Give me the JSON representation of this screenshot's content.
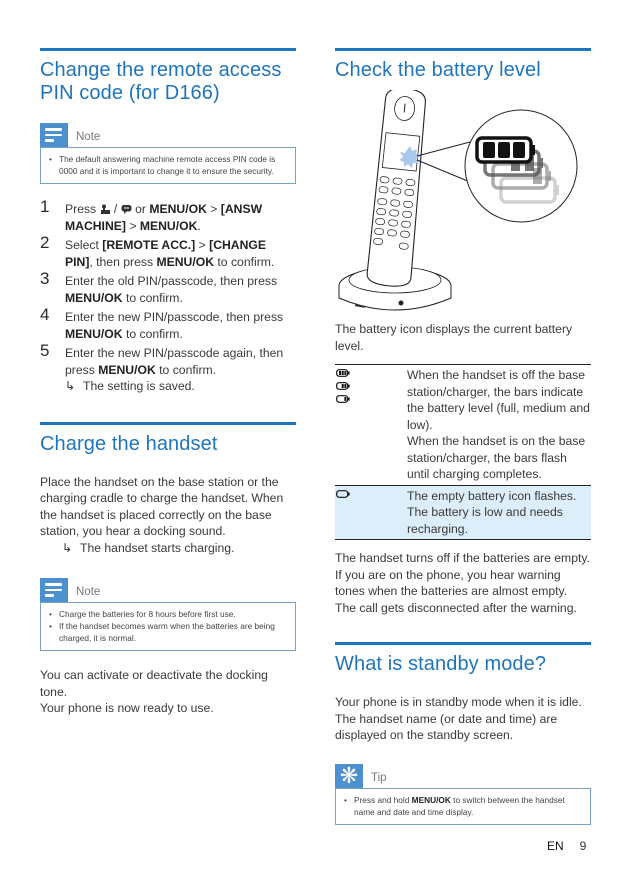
{
  "left": {
    "section1": {
      "title_line1": "Change the remote access",
      "title_line2": "PIN code (for D166)",
      "note": {
        "label": "Note",
        "icon": "note-icon",
        "items": [
          "The default answering machine remote access PIN code is 0000 and it is important to change it to ensure the security."
        ]
      },
      "steps": [
        {
          "num": "1",
          "parts": {
            "pre": "Press ",
            "icon1": "answering-machine-icon",
            "sep": " / ",
            "icon2": "message-icon",
            "mid": " or ",
            "bold1": "MENU/OK",
            "gt": " > ",
            "bold2": "[ANSW MACHINE]",
            "gt2": " > ",
            "bold3": "MENU/OK",
            "end": "."
          }
        },
        {
          "num": "2",
          "parts": {
            "pre": "Select ",
            "bold1": "[REMOTE ACC.]",
            "gt": " > ",
            "bold2": "[CHANGE PIN]",
            "mid": ", then press ",
            "bold3": "MENU/OK",
            "end": " to confirm."
          }
        },
        {
          "num": "3",
          "parts": {
            "pre": "Enter the old PIN/passcode, then press ",
            "bold1": "MENU/OK",
            "end": " to confirm."
          }
        },
        {
          "num": "4",
          "parts": {
            "pre": "Enter the new PIN/passcode, then press ",
            "bold1": "MENU/OK",
            "end": " to confirm."
          }
        },
        {
          "num": "5",
          "parts": {
            "pre": "Enter the new PIN/passcode again, then press ",
            "bold1": "MENU/OK",
            "end": " to confirm."
          },
          "result": "The setting is saved."
        }
      ]
    },
    "section2": {
      "title": "Charge the handset",
      "paragraph": "Place the handset on the base station or the charging cradle to charge the handset. When the handset is placed correctly on the base station, you hear a docking sound.",
      "result": "The handset starts charging.",
      "note": {
        "label": "Note",
        "icon": "note-icon",
        "items": [
          "Charge the batteries for 8 hours before first use.",
          "If the handset becomes warm when the batteries are being charged, it is normal."
        ]
      },
      "closing_line1": "You can activate or deactivate the docking tone.",
      "closing_line2": "Your phone is now ready to use."
    }
  },
  "right": {
    "section3": {
      "title": "Check the battery level",
      "illustration": "phone-base-battery-illustration",
      "intro": "The battery icon displays the current battery level.",
      "table": [
        {
          "icons": [
            "battery-full-icon",
            "battery-medium-icon",
            "battery-low-icon"
          ],
          "text1": "When the handset is off the base station/charger, the bars indicate the battery level (full, medium and low).",
          "text2": "When the handset is on the base station/charger, the bars flash until charging completes.",
          "highlight": false
        },
        {
          "icons": [
            "battery-empty-icon"
          ],
          "text1": "The empty battery icon flashes. The battery is low and needs recharging.",
          "highlight": true
        }
      ],
      "after": "The handset turns off if the batteries are empty. If you are on the phone, you hear warning tones when the batteries are almost empty. The call gets disconnected after the warning."
    },
    "section4": {
      "title": "What is standby mode?",
      "paragraph": "Your phone is in standby mode when it is idle. The handset name (or date and time) are displayed on the standby screen.",
      "tip": {
        "label": "Tip",
        "icon": "tip-icon",
        "pre": "Press and hold ",
        "bold": "MENU/OK",
        "post": " to switch between the handset name and date and time display."
      }
    }
  },
  "footer": {
    "lang": "EN",
    "page": "9"
  },
  "colors": {
    "heading": "#1f75b9",
    "callout_icon": "#4d90cf",
    "table_highlight": "#dbeef9"
  }
}
